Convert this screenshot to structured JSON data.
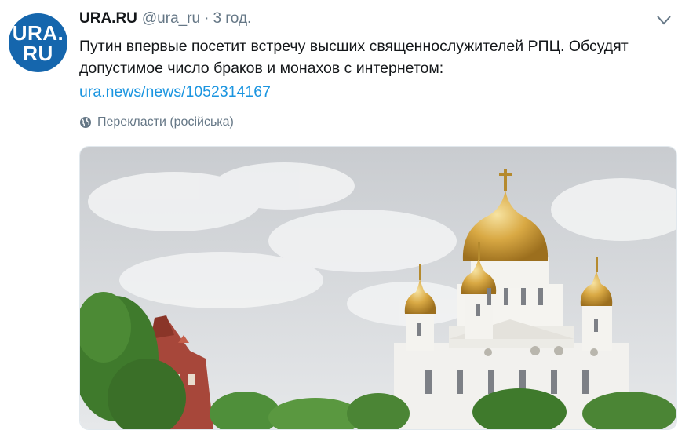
{
  "avatar": {
    "line1": "URA.",
    "line2": "RU"
  },
  "tweet": {
    "author_name": "URA.RU",
    "handle": "@ura_ru",
    "separator": "·",
    "time": "3 год.",
    "text": "Путин впервые посетит встречу высших священнослужителей РПЦ. Обсудят допустимое число браков и монахов с интернетом:",
    "link": "ura.news/news/1052314167",
    "translate_label": "Перекласти (російська)"
  },
  "icons": {
    "menu": "chevron-down-icon",
    "translate": "globe-icon"
  },
  "colors": {
    "avatar_bg": "#1566ad",
    "link": "#1b95e0",
    "muted": "#657786"
  }
}
